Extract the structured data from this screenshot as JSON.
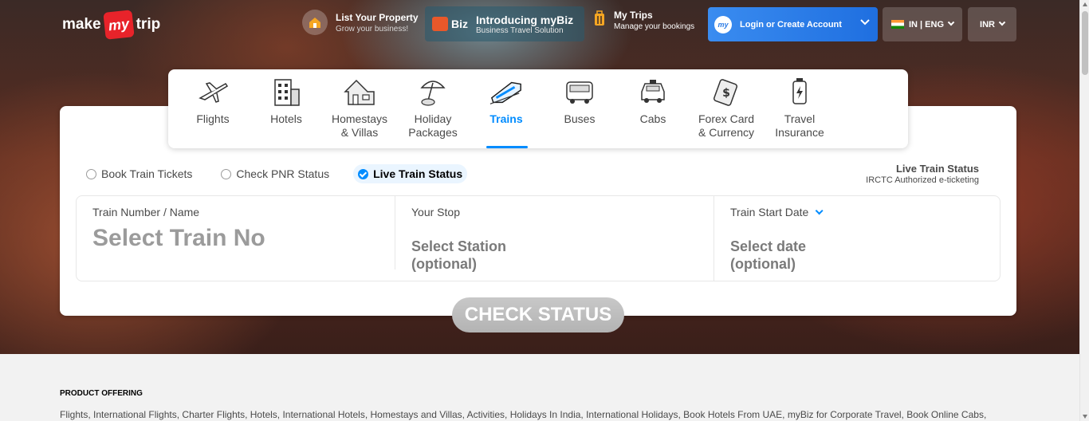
{
  "header": {
    "logo": {
      "make": "make",
      "my": "my",
      "trip": "trip"
    },
    "list_property": {
      "title": "List Your Property",
      "subtitle": "Grow your business!"
    },
    "mybiz": {
      "badge": "Biz",
      "title": "Introducing myBiz",
      "subtitle": "Business Travel Solution"
    },
    "my_trips": {
      "title": "My Trips",
      "subtitle": "Manage your bookings"
    },
    "login": {
      "avatar": "my",
      "label": "Login or Create Account"
    },
    "language": {
      "label": "IN | ENG"
    },
    "currency": {
      "label": "INR"
    }
  },
  "nav": {
    "items": [
      {
        "label": "Flights",
        "icon": "plane-icon"
      },
      {
        "label": "Hotels",
        "icon": "hotel-icon"
      },
      {
        "label": "Homestays\n& Villas",
        "icon": "house-icon"
      },
      {
        "label": "Holiday\nPackages",
        "icon": "umbrella-icon"
      },
      {
        "label": "Trains",
        "icon": "train-icon",
        "active": true
      },
      {
        "label": "Buses",
        "icon": "bus-icon"
      },
      {
        "label": "Cabs",
        "icon": "cab-icon"
      },
      {
        "label": "Forex Card\n& Currency",
        "icon": "forex-icon"
      },
      {
        "label": "Travel\nInsurance",
        "icon": "insurance-icon"
      }
    ]
  },
  "options": {
    "book": "Book Train Tickets",
    "pnr": "Check PNR Status",
    "live": "Live Train Status",
    "selected": "Live Train Status"
  },
  "status_header": {
    "title": "Live Train Status",
    "subtitle": "IRCTC Authorized e-ticketing"
  },
  "form": {
    "train": {
      "label": "Train Number / Name",
      "value": "Select Train No"
    },
    "stop": {
      "label": "Your Stop",
      "value_line1": "Select Station",
      "value_line2": "(optional)"
    },
    "date": {
      "label": "Train Start Date",
      "value_line1": "Select date",
      "value_line2": "(optional)"
    }
  },
  "check_button": "CHECK STATUS",
  "footer": {
    "heading": "PRODUCT OFFERING",
    "links": "Flights, International Flights, Charter Flights, Hotels, International Hotels, Homestays and Villas, Activities, Holidays In India, International Holidays, Book Hotels From UAE, myBiz for Corporate Travel, Book Online Cabs,"
  },
  "colors": {
    "accent": "#008cff",
    "brand_red": "#e8232a",
    "login_blue": "#2a7ae4",
    "button_gray": "#bdbdbd"
  }
}
